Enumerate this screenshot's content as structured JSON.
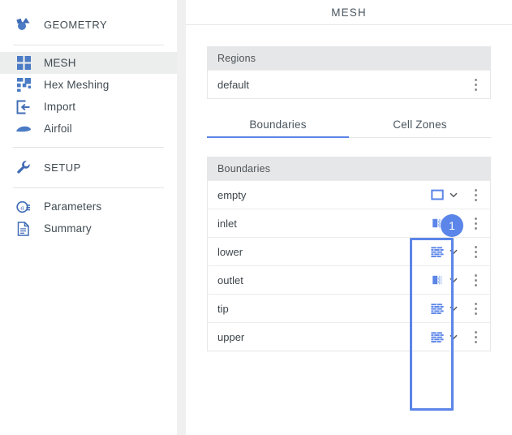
{
  "sidebar": {
    "groups": [
      {
        "id": "geometry",
        "header": {
          "label": "GEOMETRY",
          "icon": "geometry-shapes-icon"
        },
        "items": [
          {
            "label": "MESH",
            "icon": "grid-squares-icon",
            "active": true
          },
          {
            "label": "Hex Meshing",
            "icon": "hex-blocks-icon",
            "active": false
          },
          {
            "label": "Import",
            "icon": "import-arrow-icon",
            "active": false
          },
          {
            "label": "Airfoil",
            "icon": "airfoil-icon",
            "active": false
          }
        ]
      },
      {
        "id": "setup",
        "header": {
          "label": "SETUP",
          "icon": "wrench-icon"
        },
        "items": [
          {
            "label": "Parameters",
            "icon": "parameters-icon",
            "active": false
          },
          {
            "label": "Summary",
            "icon": "document-icon",
            "active": false
          }
        ]
      }
    ]
  },
  "main": {
    "title": "MESH",
    "regions": {
      "header": "Regions",
      "rows": [
        {
          "name": "default",
          "menu_icon": "kebab-menu-icon"
        }
      ]
    },
    "tabs": [
      {
        "label": "Boundaries",
        "active": true
      },
      {
        "label": "Cell Zones",
        "active": false
      }
    ],
    "boundaries": {
      "header": "Boundaries",
      "rows": [
        {
          "name": "empty",
          "type_icon": "empty-square-icon",
          "chevron": "chevron-down-icon",
          "menu_icon": "kebab-menu-icon"
        },
        {
          "name": "inlet",
          "type_icon": "inlet-patch-icon",
          "chevron": "chevron-down-icon",
          "menu_icon": "kebab-menu-icon"
        },
        {
          "name": "lower",
          "type_icon": "wall-brick-icon",
          "chevron": "chevron-down-icon",
          "menu_icon": "kebab-menu-icon"
        },
        {
          "name": "outlet",
          "type_icon": "outlet-patch-icon",
          "chevron": "chevron-down-icon",
          "menu_icon": "kebab-menu-icon"
        },
        {
          "name": "tip",
          "type_icon": "wall-brick-icon",
          "chevron": "chevron-down-icon",
          "menu_icon": "kebab-menu-icon"
        },
        {
          "name": "upper",
          "type_icon": "wall-brick-icon",
          "chevron": "chevron-down-icon",
          "menu_icon": "kebab-menu-icon"
        }
      ]
    }
  },
  "annotation": {
    "badge_number": "1"
  },
  "colors": {
    "accent": "#5b85e8",
    "icon_blue": "#3f6bb5",
    "header_gray": "#e6e7e8",
    "active_row": "#eceded",
    "text": "#404b52",
    "splitter": "#f0f0f0"
  }
}
